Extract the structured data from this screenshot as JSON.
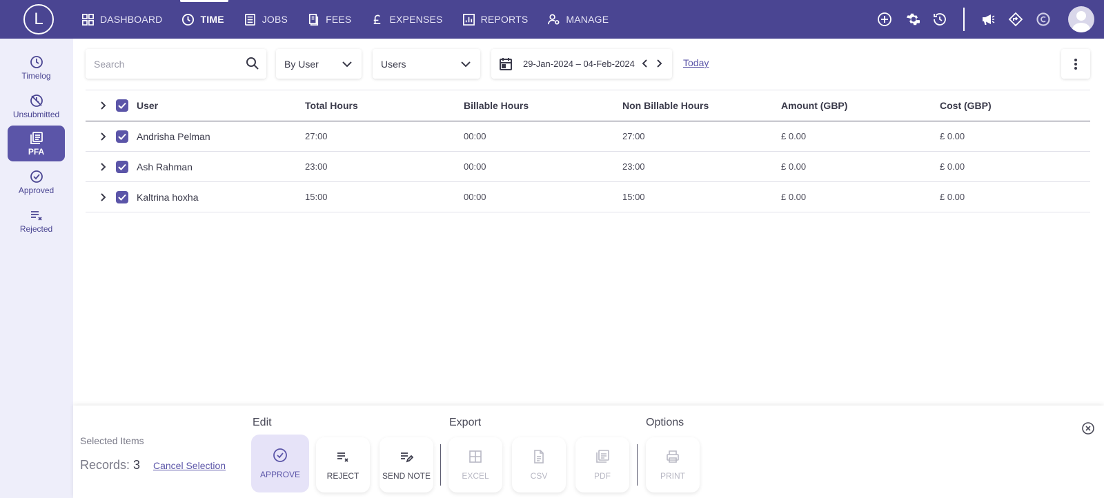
{
  "app": {
    "logo_letter": "L"
  },
  "nav": {
    "items": [
      {
        "label": "DASHBOARD",
        "icon": "dashboard-icon",
        "active": false
      },
      {
        "label": "TIME",
        "icon": "clock-icon",
        "active": true
      },
      {
        "label": "JOBS",
        "icon": "jobs-icon",
        "active": false
      },
      {
        "label": "FEES",
        "icon": "fees-icon",
        "active": false
      },
      {
        "label": "EXPENSES",
        "icon": "pound-icon",
        "active": false
      },
      {
        "label": "REPORTS",
        "icon": "reports-icon",
        "active": false
      },
      {
        "label": "MANAGE",
        "icon": "manage-icon",
        "active": false
      }
    ]
  },
  "sidebar": {
    "items": [
      {
        "label": "Timelog",
        "icon": "clock-icon",
        "active": false
      },
      {
        "label": "Unsubmitted",
        "icon": "unsubmitted-icon",
        "active": false
      },
      {
        "label": "PFA",
        "icon": "pfa-icon",
        "active": true
      },
      {
        "label": "Approved",
        "icon": "check-circle-icon",
        "active": false
      },
      {
        "label": "Rejected",
        "icon": "reject-list-icon",
        "active": false
      }
    ]
  },
  "filters": {
    "search_placeholder": "Search",
    "group_by": "By User",
    "users": "Users",
    "date_range": "29-Jan-2024 – 04-Feb-2024",
    "today_label": "Today"
  },
  "table": {
    "headers": {
      "user": "User",
      "total": "Total Hours",
      "billable": "Billable Hours",
      "non_billable": "Non Billable Hours",
      "amount": "Amount (GBP)",
      "cost": "Cost (GBP)"
    },
    "rows": [
      {
        "user": "Andrisha Pelman",
        "total": "27:00",
        "billable": "00:00",
        "non_billable": "27:00",
        "amount": "£ 0.00",
        "cost": "£ 0.00"
      },
      {
        "user": "Ash Rahman",
        "total": "23:00",
        "billable": "00:00",
        "non_billable": "23:00",
        "amount": "£ 0.00",
        "cost": "£ 0.00"
      },
      {
        "user": "Kaltrina hoxha",
        "total": "15:00",
        "billable": "00:00",
        "non_billable": "15:00",
        "amount": "£ 0.00",
        "cost": "£ 0.00"
      }
    ]
  },
  "bottom": {
    "selected_label": "Selected Items",
    "records_label": "Records:",
    "records_count": "3",
    "cancel_label": "Cancel Selection",
    "groups": {
      "edit": "Edit",
      "export": "Export",
      "options": "Options"
    },
    "buttons": {
      "approve": "APPROVE",
      "reject": "REJECT",
      "send_note": "SEND NOTE",
      "excel": "EXCEL",
      "csv": "CSV",
      "pdf": "PDF",
      "print": "PRINT"
    }
  },
  "colors": {
    "brand": "#4a4592",
    "accent": "#5b55a8",
    "sidebar_bg": "#eeeefa"
  }
}
